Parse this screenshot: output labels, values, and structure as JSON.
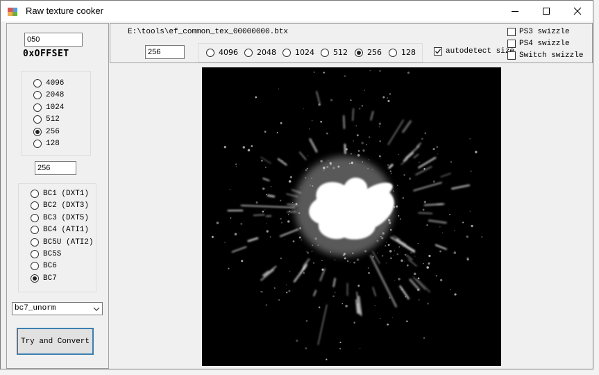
{
  "window": {
    "title": "Raw texture cooker",
    "controls": {
      "minimize": "minimize-icon",
      "maximize": "maximize-icon",
      "close": "close-icon"
    }
  },
  "left_panel": {
    "offset_value": "050",
    "offset_label": "0xOFFSET",
    "size_options": [
      "4096",
      "2048",
      "1024",
      "512",
      "256",
      "128"
    ],
    "size_selected": "256",
    "size_value": "256",
    "format_options": [
      "BC1 (DXT1)",
      "BC2 (DXT3)",
      "BC3 (DXT5)",
      "BC4 (ATI1)",
      "BC5U (ATI2)",
      "BC5S",
      "BC6",
      "BC7"
    ],
    "format_selected": "BC7",
    "subformat": "bc7_unorm",
    "convert_label": "Try and Convert"
  },
  "top_panel": {
    "file_path": "E:\\tools\\ef_common_tex_00000000.btx",
    "width_value": "256",
    "size_options": [
      "4096",
      "2048",
      "1024",
      "512",
      "256",
      "128"
    ],
    "size_selected": "256",
    "autodetect_label": "autodetect size",
    "autodetect_checked": true,
    "swizzle": [
      {
        "label": "PS3 swizzle",
        "checked": false
      },
      {
        "label": "PS4 swizzle",
        "checked": false
      },
      {
        "label": "Switch swizzle",
        "checked": false
      }
    ]
  },
  "colors": {
    "accent": "#3c7fb1",
    "preview_bg": "#000000",
    "window_bg": "#f0f0f0"
  }
}
